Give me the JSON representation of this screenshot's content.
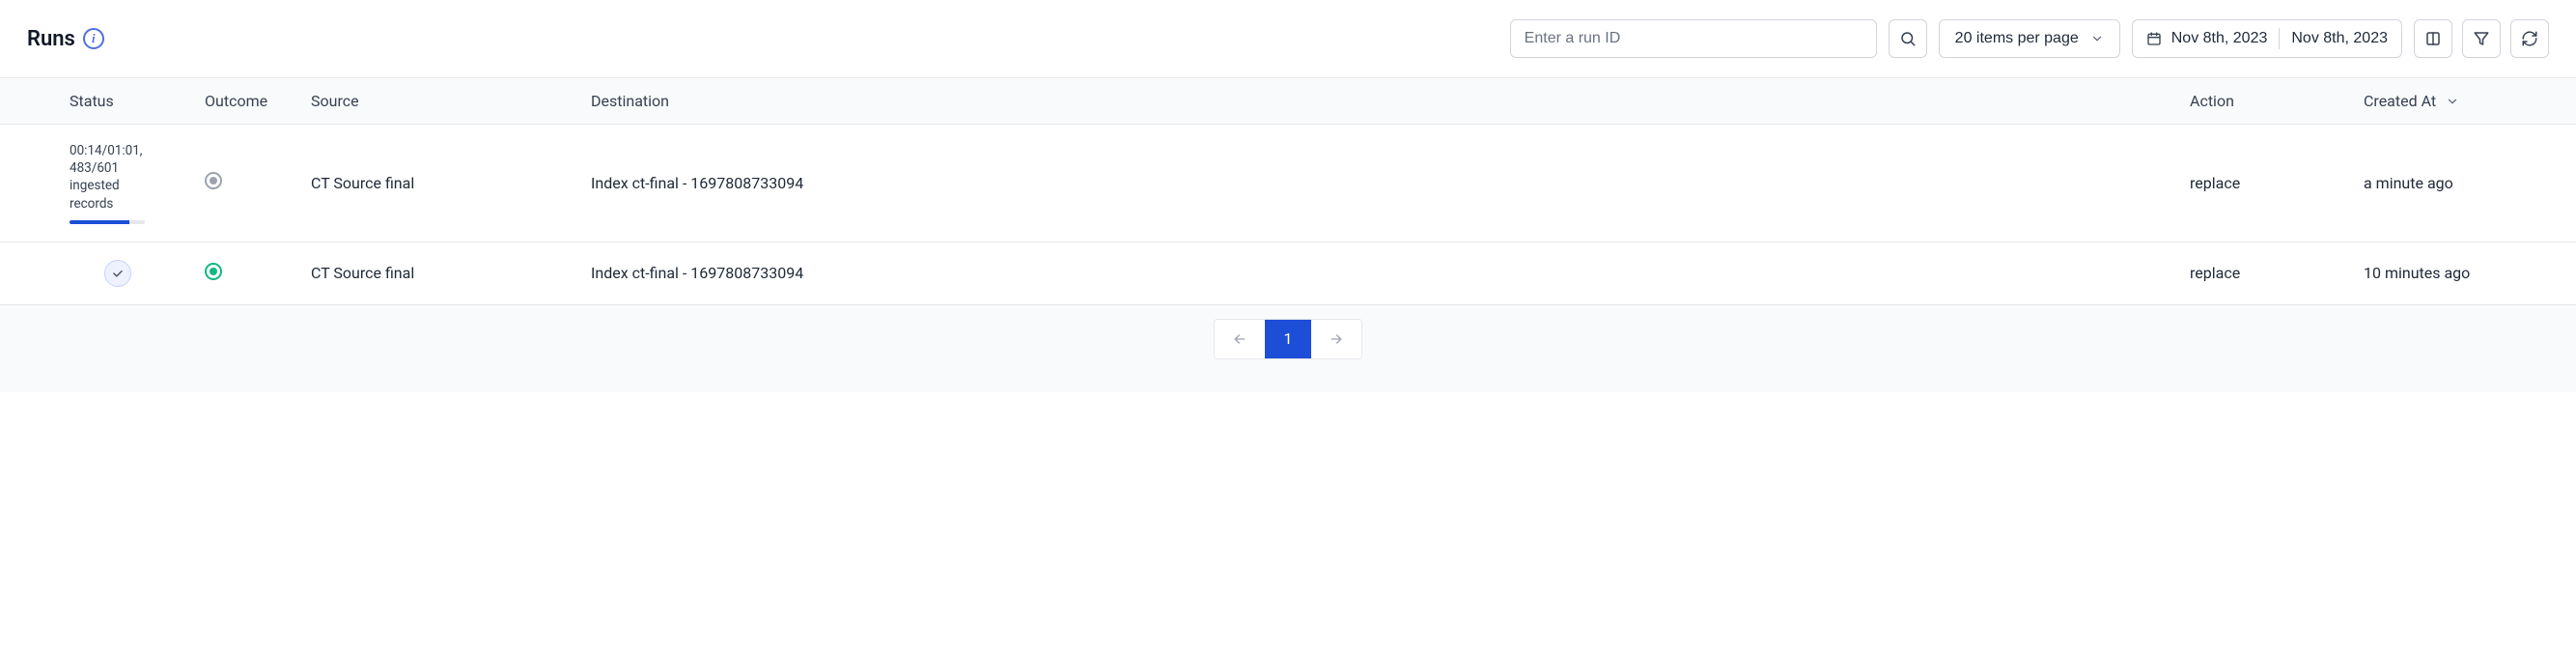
{
  "header": {
    "title": "Runs",
    "search_placeholder": "Enter a run ID",
    "items_per_page_label": "20 items per page",
    "date_from": "Nov 8th, 2023",
    "date_to": "Nov 8th, 2023"
  },
  "columns": {
    "status": "Status",
    "outcome": "Outcome",
    "source": "Source",
    "destination": "Destination",
    "action": "Action",
    "created_at": "Created At"
  },
  "rows": [
    {
      "status_line1": "00:14/01:01,",
      "status_line2": "483/601",
      "status_line3": "ingested",
      "status_line4": "records",
      "progress_percent": 80,
      "outcome": "running",
      "source": "CT Source final",
      "destination": "Index ct-final - 1697808733094",
      "action": "replace",
      "created_at": "a minute ago"
    },
    {
      "status_done": true,
      "outcome": "success",
      "source": "CT Source final",
      "destination": "Index ct-final - 1697808733094",
      "action": "replace",
      "created_at": "10 minutes ago"
    }
  ],
  "pagination": {
    "current_page": "1"
  }
}
